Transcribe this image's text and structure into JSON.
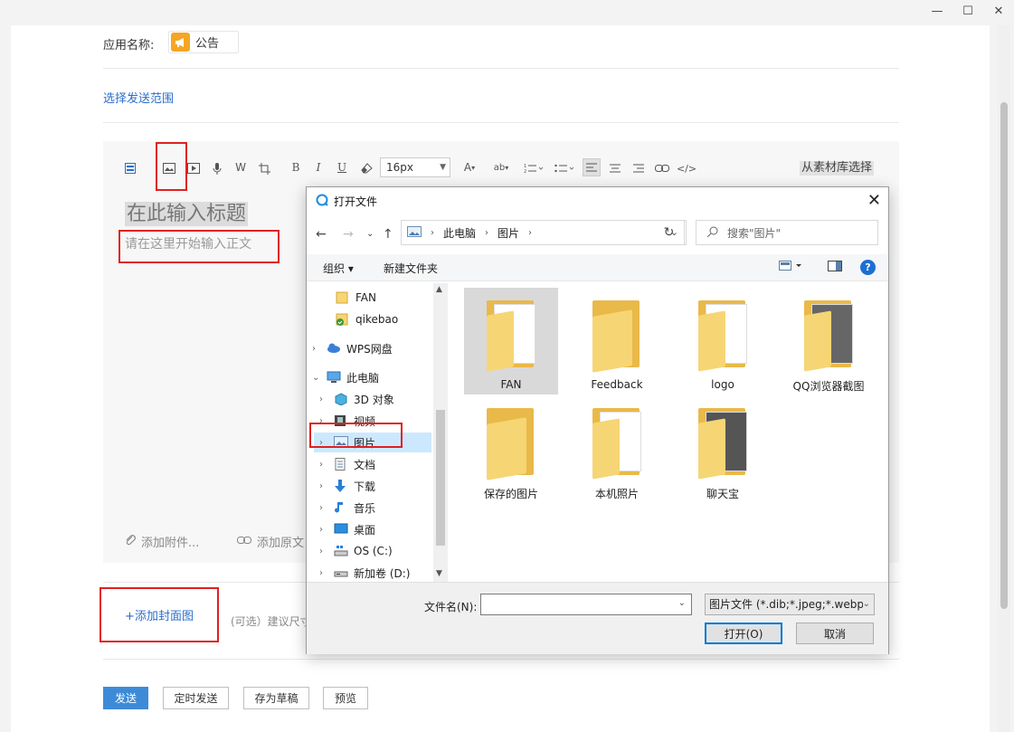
{
  "window": {
    "minimize": "—",
    "maximize": "☐",
    "close": "✕"
  },
  "app": {
    "label": "应用名称:",
    "name": "公告",
    "icon": "megaphone-icon",
    "icon_color": "#f5a623"
  },
  "scope_link": "选择发送范围",
  "toolbar": {
    "font_size": "16px",
    "items": [
      "B",
      "I",
      "U",
      "W",
      "A",
      "ab"
    ],
    "material_label": "从素材库选择"
  },
  "editor": {
    "title_placeholder": "在此输入标题",
    "body_placeholder": "请在这里开始输入正文",
    "attach_label": "添加附件...",
    "link_label": "添加原文"
  },
  "cover": {
    "label": "+添加封面图",
    "hint": "(可选）建议尺寸"
  },
  "actions": {
    "send": "发送",
    "schedule": "定时发送",
    "draft": "存为草稿",
    "preview": "预览"
  },
  "accent_color": "#3d8bd8",
  "highlight_color": "#e02020",
  "dialog": {
    "title": "打开文件",
    "path": [
      "此电脑",
      "图片"
    ],
    "search_placeholder": "搜索\"图片\"",
    "organize": "组织 ▾",
    "new_folder": "新建文件夹",
    "tree": [
      "FAN",
      "qikebao",
      "WPS网盘",
      "此电脑",
      "3D 对象",
      "视频",
      "图片",
      "文档",
      "下载",
      "音乐",
      "桌面",
      "OS (C:)",
      "新加卷 (D:)"
    ],
    "files": [
      "FAN",
      "Feedback",
      "logo",
      "QQ浏览器截图",
      "保存的图片",
      "本机照片",
      "聊天宝"
    ],
    "filename_label": "文件名(N):",
    "filename_value": "",
    "filetype": "图片文件 (*.dib;*.jpeg;*.webp;",
    "open_btn": "打开(O)",
    "cancel_btn": "取消"
  }
}
